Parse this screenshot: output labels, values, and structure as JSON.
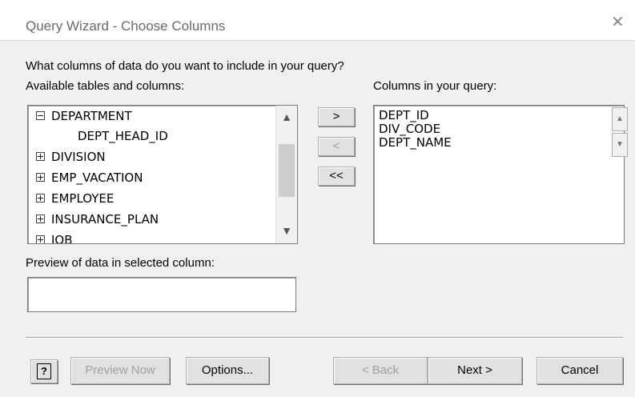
{
  "window": {
    "title": "Query Wizard - Choose Columns",
    "close_glyph": "✕"
  },
  "prompt": "What columns of data do you want to include in your query?",
  "available": {
    "label": "Available tables and columns:",
    "items": [
      {
        "text": "DEPARTMENT",
        "type": "expanded-table"
      },
      {
        "text": "DEPT_HEAD_ID",
        "type": "column"
      },
      {
        "text": "DIVISION",
        "type": "collapsed-table"
      },
      {
        "text": "EMP_VACATION",
        "type": "collapsed-table"
      },
      {
        "text": "EMPLOYEE",
        "type": "collapsed-table"
      },
      {
        "text": "INSURANCE_PLAN",
        "type": "collapsed-table"
      },
      {
        "text": "JOB",
        "type": "collapsed-table"
      }
    ]
  },
  "move_buttons": {
    "add": ">",
    "remove": "<",
    "remove_all": "<<"
  },
  "selected": {
    "label": "Columns in your query:",
    "items": [
      "DEPT_ID",
      "DIV_CODE",
      "DEPT_NAME"
    ]
  },
  "preview": {
    "label": "Preview of data in selected column:",
    "value": ""
  },
  "footer": {
    "help": "?",
    "preview_now": "Preview Now",
    "options": "Options...",
    "back": "< Back",
    "next": "Next >",
    "cancel": "Cancel"
  },
  "icons": {
    "up_arrow": "▲",
    "down_arrow": "▼",
    "scroll_up": "▲",
    "scroll_down": "▼"
  }
}
